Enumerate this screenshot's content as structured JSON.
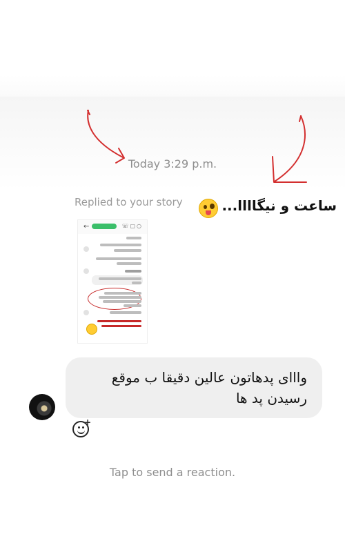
{
  "thread": {
    "timestamp": "Today 3:29 p.m.",
    "replied_label": "Replied to your story",
    "story_caption": "ساعت و نیگاااا...",
    "story_caption_emoji": "zany-face-emoji"
  },
  "message": {
    "text": "وااای پدهاتون عالین دقیقا ب موقع رسیدن پد ها"
  },
  "reaction": {
    "hint": "Tap to send a reaction.",
    "icon": "add-reaction-icon"
  },
  "colors": {
    "annotation_arrow": "#d32f2f",
    "bubble": "#efefef",
    "muted_text": "#8e8e8e"
  }
}
